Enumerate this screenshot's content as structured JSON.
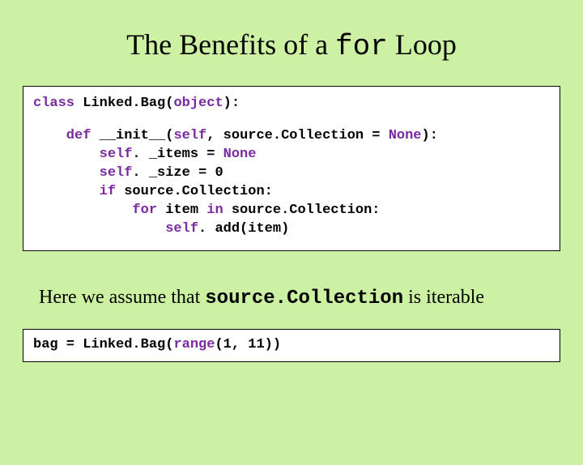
{
  "title": {
    "pre": "The Benefits of a ",
    "kw": "for",
    "post": " Loop"
  },
  "code1": {
    "l1a": "class",
    "l1b": " Linked.Bag(",
    "l1c": "object",
    "l1d": "):",
    "l2a": "    def",
    "l2b": " __init__(",
    "l2c": "self",
    "l2d": ", source.Collection = ",
    "l2e": "None",
    "l2f": "):",
    "l3a": "        self",
    "l3b": ". _items = ",
    "l3c": "None",
    "l4a": "        self",
    "l4b": ". _size = 0",
    "l5a": "        if",
    "l5b": " source.Collection:",
    "l6a": "            for",
    "l6b": " item ",
    "l6c": "in",
    "l6d": " source.Collection:",
    "l7a": "                self",
    "l7b": ". add(item)"
  },
  "caption": {
    "pre": "Here we assume that ",
    "mono": "source.Collection",
    "post": " is iterable"
  },
  "code2": {
    "a": "bag = Linked.Bag(",
    "b": "range",
    "c": "(1, 11))"
  }
}
